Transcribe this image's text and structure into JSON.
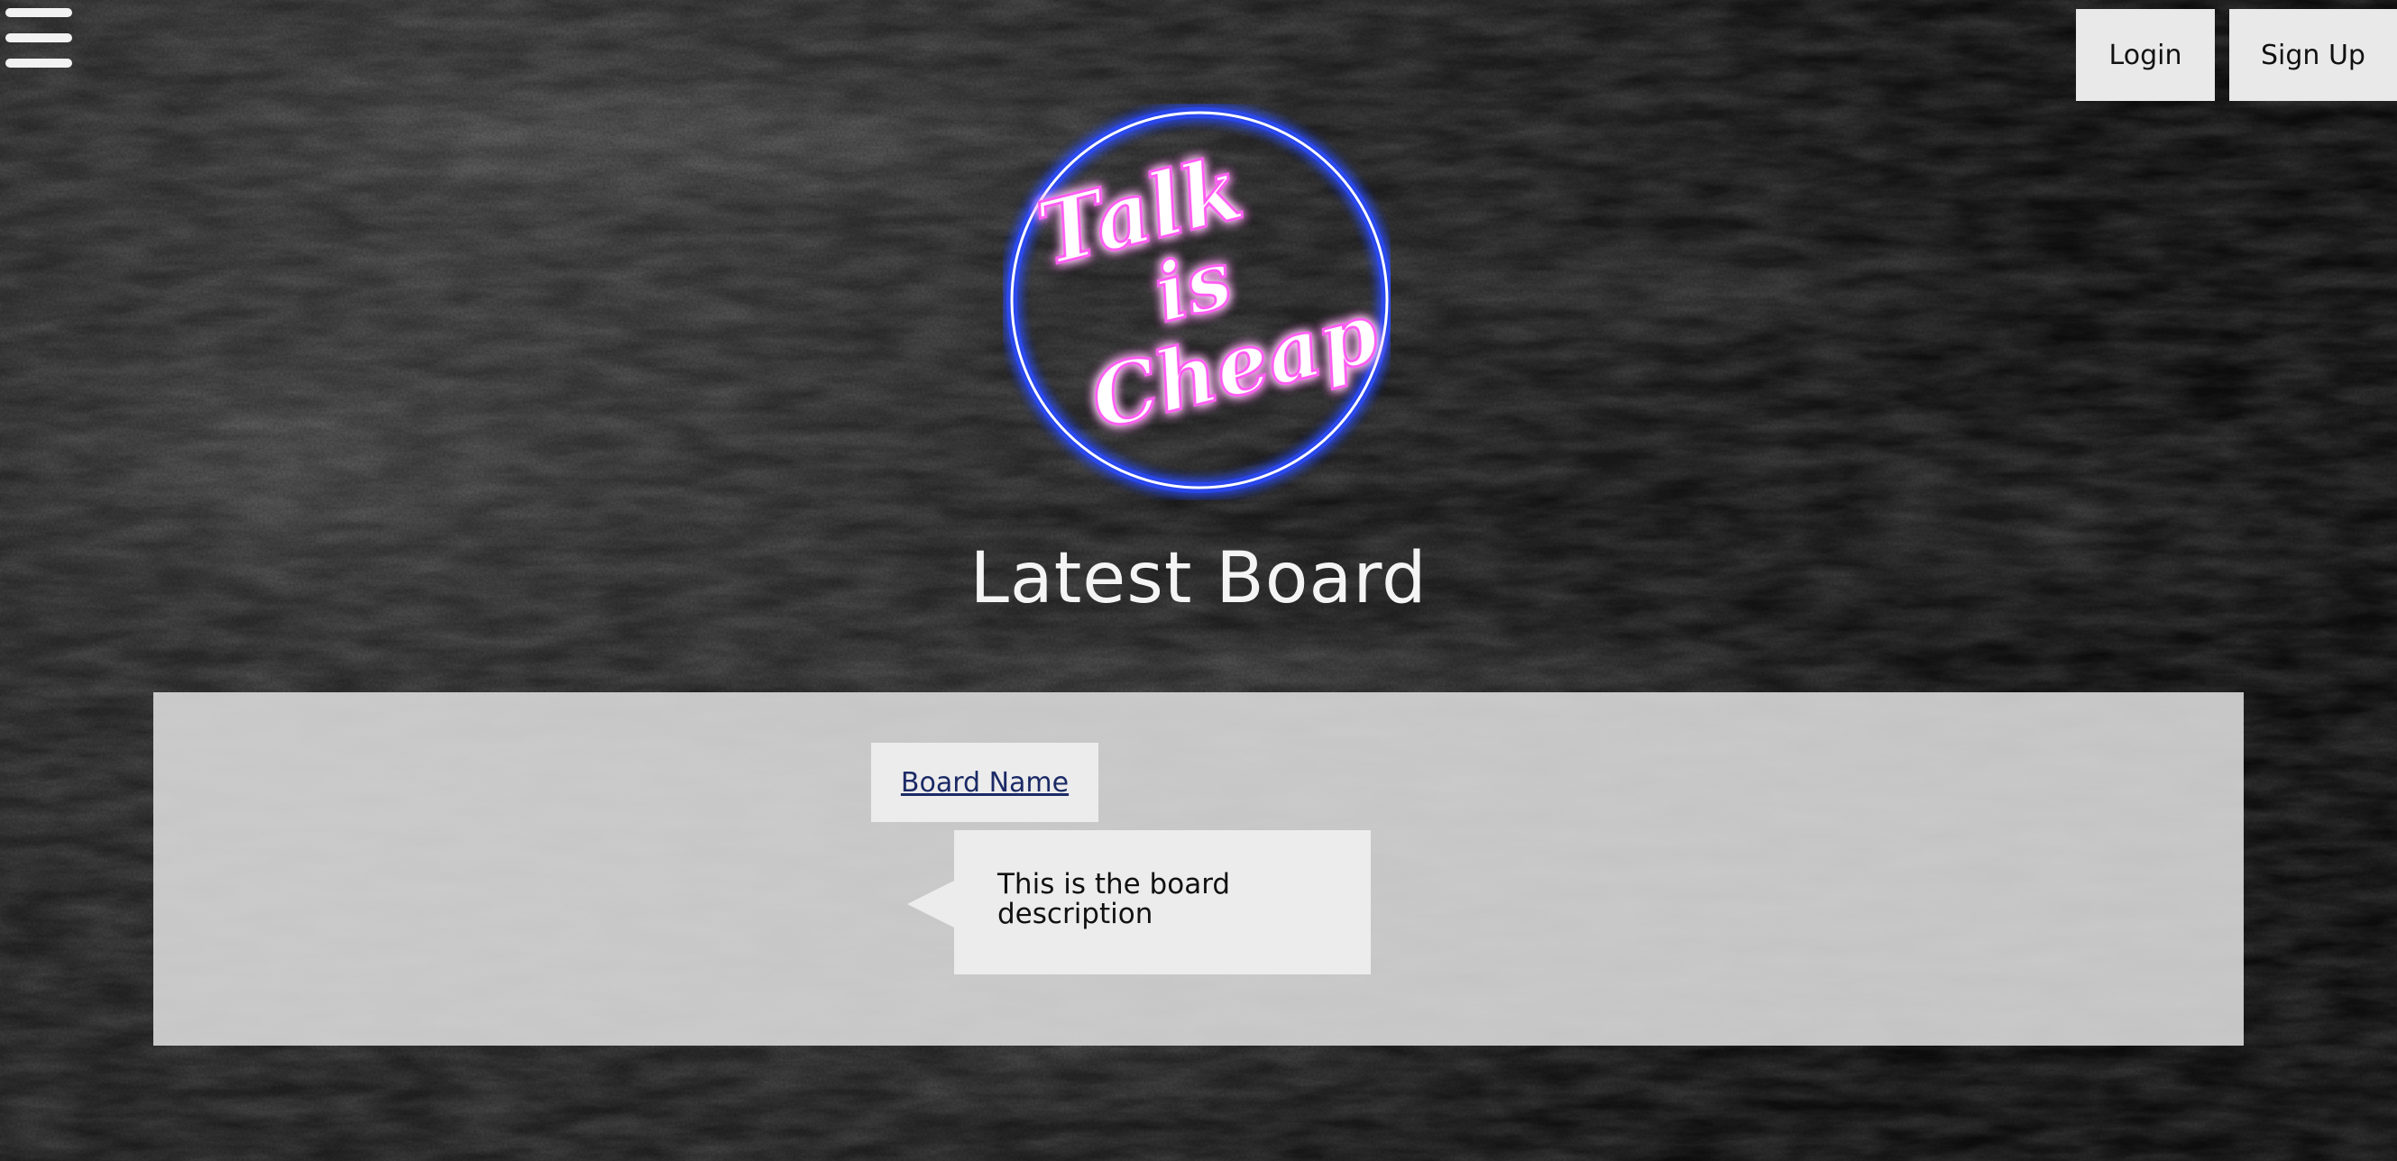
{
  "header": {
    "menu_icon": "hamburger-menu-icon",
    "login_label": "Login",
    "signup_label": "Sign Up"
  },
  "logo": {
    "lines": [
      "Talk",
      "is",
      "Cheap"
    ],
    "ring_color": "#2a4bff",
    "text_color": "#ff66ff"
  },
  "main": {
    "title": "Latest Board",
    "board": {
      "name": "Board Name",
      "description": "This is the board description"
    }
  }
}
